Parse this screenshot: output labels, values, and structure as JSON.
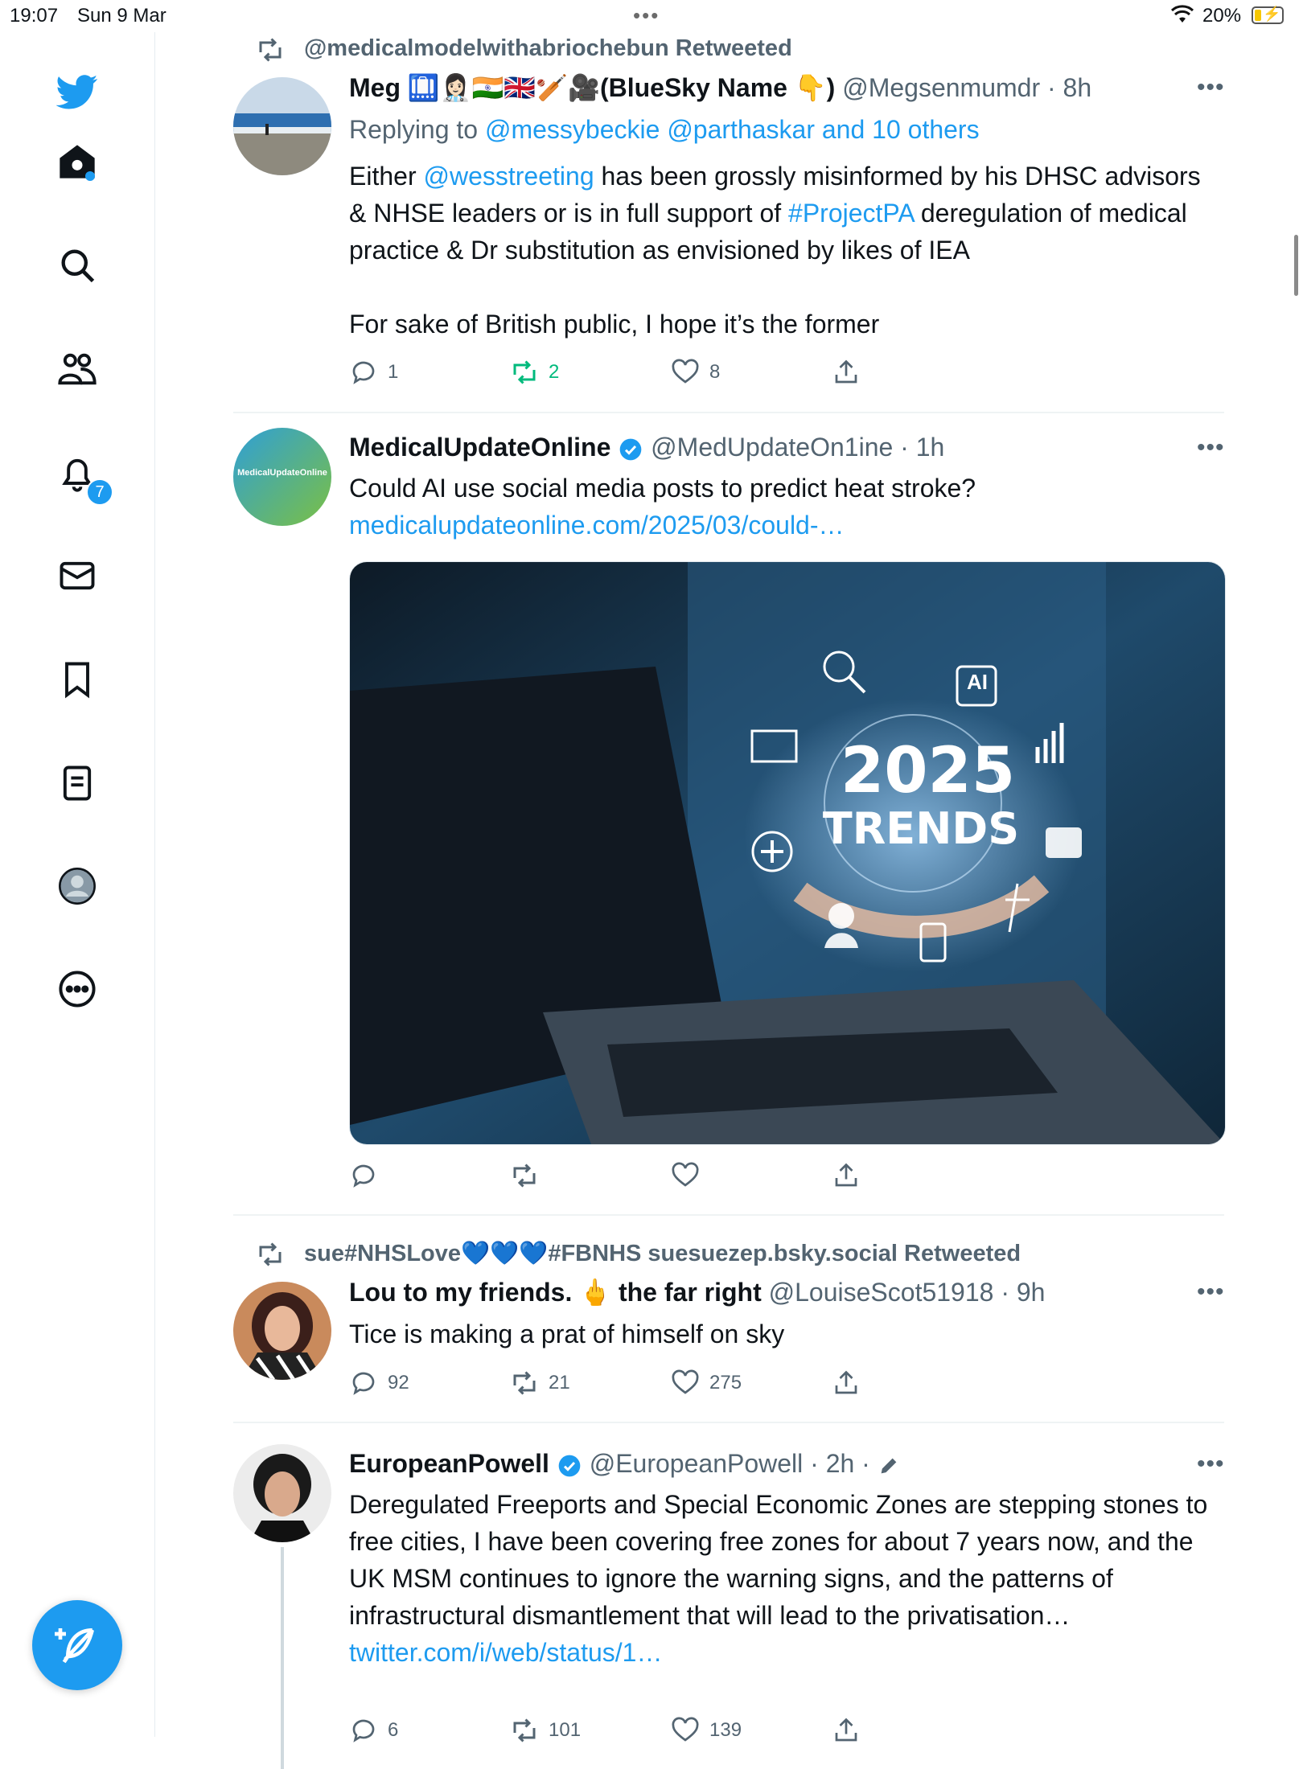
{
  "status": {
    "time": "19:07",
    "date": "Sun 9 Mar",
    "battery": "20%"
  },
  "sidebar": {
    "notifications_count": "7"
  },
  "tweets": [
    {
      "retweeted_by": "@medicalmodelwithabriochebun Retweeted",
      "name": "Meg 🛄👩🏻‍⚕️🇮🇳🇬🇧🏏🎥(BlueSky Name 👇)",
      "handle": "@Megsenmumdr",
      "time": "· 8h",
      "replying_prefix": "Replying to ",
      "replying_to": "@messybeckie @parthaskar and 10 others",
      "text_parts": [
        "Either ",
        "@wesstreeting",
        " has been grossly misinformed by his DHSC advisors & NHSE leaders or is in full support of ",
        "#ProjectPA",
        " deregulation of medical practice & Dr substitution as envisioned by likes of IEA"
      ],
      "text_2": "For sake of British public, I hope it’s the former",
      "replies": "1",
      "retweets": "2",
      "likes": "8"
    },
    {
      "name": "MedicalUpdateOnline",
      "handle": "@MedUpdateOn1ine",
      "time": "· 1h",
      "text": "Could AI use social media posts to predict heat stroke?",
      "link": "medicalupdateonline.com/2025/03/could-…",
      "avatar_text": "MedicalUpdateOnline",
      "media": {
        "year": "2025",
        "word": "TRENDS",
        "ai": "AI"
      }
    },
    {
      "retweeted_by": "sue#NHSLove💙💙💙#FBNHS suesuezep.bsky.social Retweeted",
      "name": "Lou to my friends. 🖕 the far right",
      "handle": "@LouiseScot51918",
      "time": "· 9h",
      "text": "Tice is making a prat of himself on sky",
      "replies": "92",
      "retweets": "21",
      "likes": "275"
    },
    {
      "name": "EuropeanPowell",
      "handle": "@EuropeanPowell",
      "time": "· 2h ·",
      "text": "Deregulated Freeports and Special Economic Zones are stepping stones to free cities, I have been covering free zones for about 7 years now, and the UK MSM continues to ignore the warning signs, and the patterns of infrastructural dismantlement that will lead to the privatisation… ",
      "link": "twitter.com/i/web/status/1…",
      "replies": "6",
      "retweets": "101",
      "likes": "139"
    }
  ],
  "colors": {
    "accent": "#1d9bf0",
    "retweet_active": "#00ba7c",
    "muted": "#536471"
  }
}
